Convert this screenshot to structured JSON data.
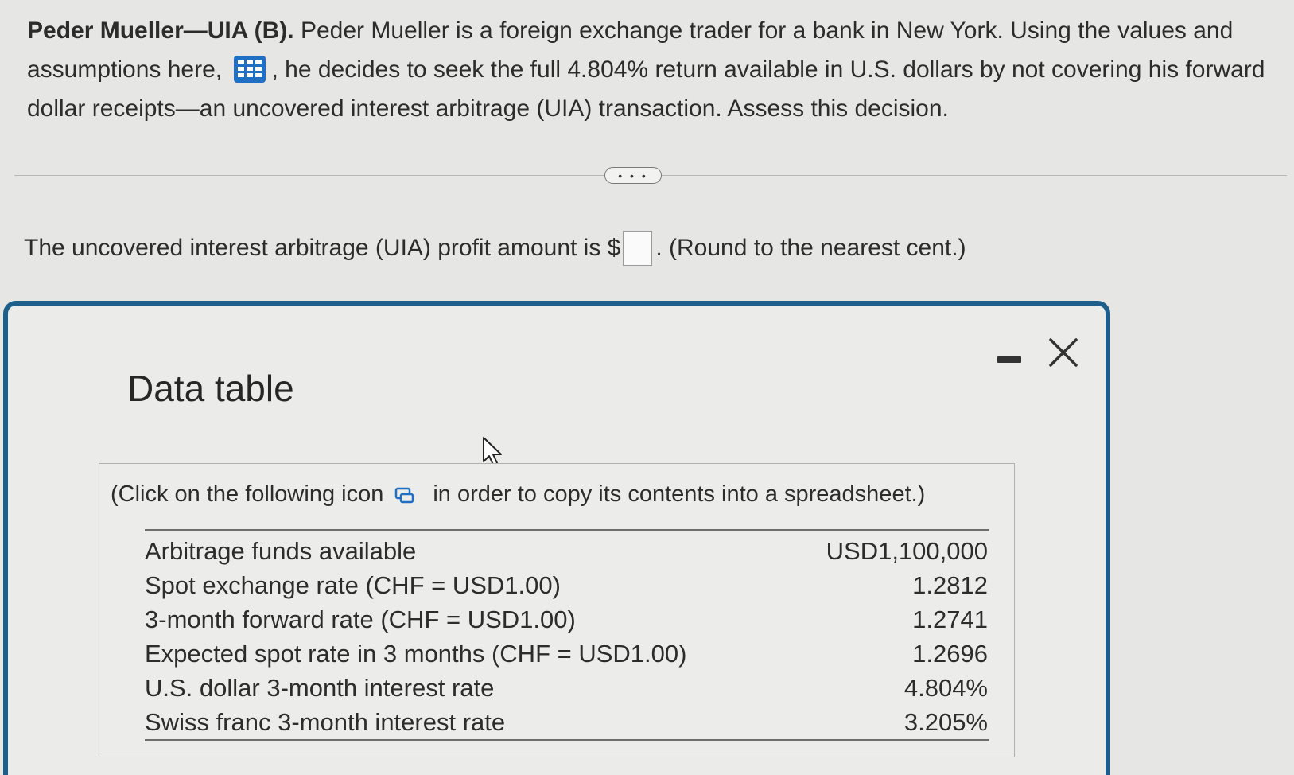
{
  "question": {
    "title": "Peder Mueller—UIA (B).",
    "text_part1": " Peder Mueller is a foreign exchange trader for a bank in New York. Using the values and assumptions here, ",
    "text_part2": ", he decides to seek the full 4.804% return available in U.S. dollars by not covering his forward dollar receipts—an uncovered interest arbitrage (UIA) transaction. Assess this decision.",
    "data_icon": "table-grid-icon"
  },
  "more_button": {
    "label": "• • •"
  },
  "answer": {
    "prefix": "The uncovered interest arbitrage (UIA) profit amount is $",
    "input_value": "",
    "suffix": ". (Round to the nearest cent.)"
  },
  "dialog": {
    "title": "Data table",
    "copy_note_before": "(Click on the following icon",
    "copy_note_after": "in order to copy its contents into a spreadsheet.)",
    "rows": [
      {
        "label": "Arbitrage funds available",
        "value": "USD1,100,000"
      },
      {
        "label": "Spot exchange rate (CHF = USD1.00)",
        "value": "1.2812"
      },
      {
        "label": "3-month forward rate (CHF = USD1.00)",
        "value": "1.2741"
      },
      {
        "label": "Expected spot rate in 3 months (CHF = USD1.00)",
        "value": "1.2696"
      },
      {
        "label": "U.S. dollar 3-month interest rate",
        "value": "4.804%"
      },
      {
        "label": "Swiss franc 3-month interest rate",
        "value": "3.205%"
      }
    ]
  },
  "colors": {
    "dialog_border": "#1d5f8a",
    "grid_icon": "#1f6fc4",
    "background": "#e6e6e4"
  }
}
